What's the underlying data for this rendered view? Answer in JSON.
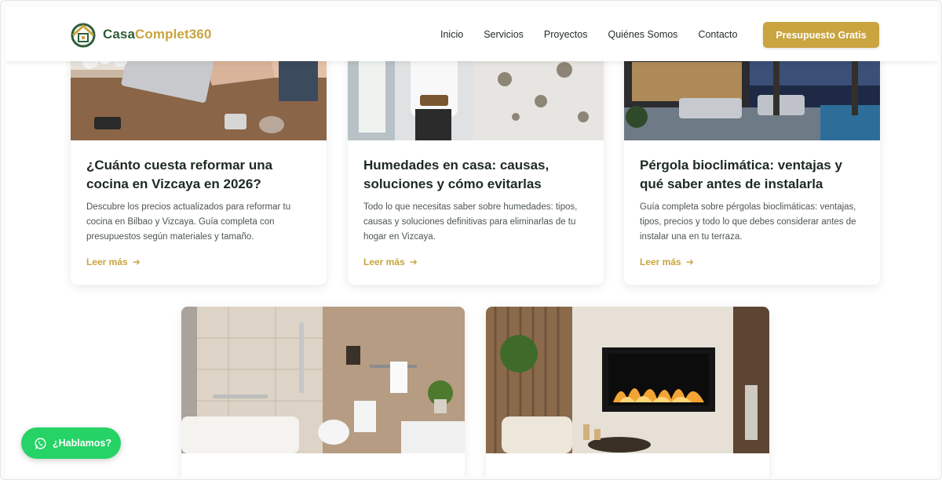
{
  "header": {
    "logo": {
      "part1": "Casa",
      "part2": "Complet360",
      "icon": "house-logo-icon"
    },
    "nav": [
      "Inicio",
      "Servicios",
      "Proyectos",
      "Quiénes Somos",
      "Contacto"
    ],
    "cta_label": "Presupuesto Gratis"
  },
  "posts": [
    {
      "title": "¿Cuánto cuesta reformar una cocina en Vizcaya en 2026?",
      "excerpt": "Descubre los precios actualizados para reformar tu cocina en Bilbao y Vizcaya. Guía completa con presupuestos según materiales y tamaño.",
      "read_more": "Leer más"
    },
    {
      "title": "Humedades en casa: causas, soluciones y cómo evitarlas",
      "excerpt": "Todo lo que necesitas saber sobre humedades: tipos, causas y soluciones definitivas para eliminarlas de tu hogar en Vizcaya.",
      "read_more": "Leer más"
    },
    {
      "title": "Pérgola bioclimática: ventajas y qué saber antes de instalarla",
      "excerpt": "Guía completa sobre pérgolas bioclimáticas: ventajas, tipos, precios y todo lo que debes considerar antes de instalar una en tu terraza.",
      "read_more": "Leer más"
    }
  ],
  "whatsapp_label": "¿Hablamos?",
  "colors": {
    "brand_green": "#2f5d3a",
    "brand_gold": "#c9a43f",
    "whatsapp": "#25d366"
  }
}
